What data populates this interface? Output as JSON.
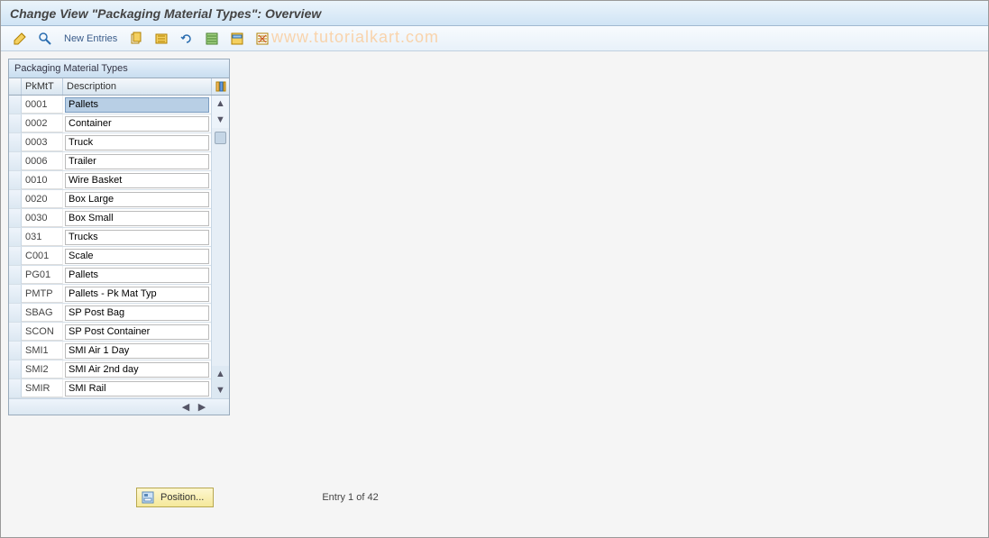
{
  "title": "Change View \"Packaging Material Types\": Overview",
  "toolbar": {
    "new_entries": "New Entries"
  },
  "watermark": "www.tutorialkart.com",
  "panel": {
    "title": "Packaging Material Types",
    "col1": "PkMtT",
    "col2": "Description"
  },
  "rows": [
    {
      "code": "0001",
      "desc": "Pallets",
      "selected": true
    },
    {
      "code": "0002",
      "desc": "Container"
    },
    {
      "code": "0003",
      "desc": "Truck"
    },
    {
      "code": "0006",
      "desc": "Trailer"
    },
    {
      "code": "0010",
      "desc": "Wire Basket"
    },
    {
      "code": "0020",
      "desc": "Box Large"
    },
    {
      "code": "0030",
      "desc": "Box Small"
    },
    {
      "code": "031",
      "desc": "Trucks"
    },
    {
      "code": "C001",
      "desc": "Scale"
    },
    {
      "code": "PG01",
      "desc": "Pallets"
    },
    {
      "code": "PMTP",
      "desc": "Pallets - Pk Mat Typ"
    },
    {
      "code": "SBAG",
      "desc": "SP Post Bag"
    },
    {
      "code": "SCON",
      "desc": "SP Post Container"
    },
    {
      "code": "SMI1",
      "desc": "SMI Air 1 Day"
    },
    {
      "code": "SMI2",
      "desc": "SMI Air 2nd day"
    },
    {
      "code": "SMIR",
      "desc": "SMI Rail"
    }
  ],
  "footer": {
    "position_label": "Position...",
    "status": "Entry 1 of 42"
  }
}
